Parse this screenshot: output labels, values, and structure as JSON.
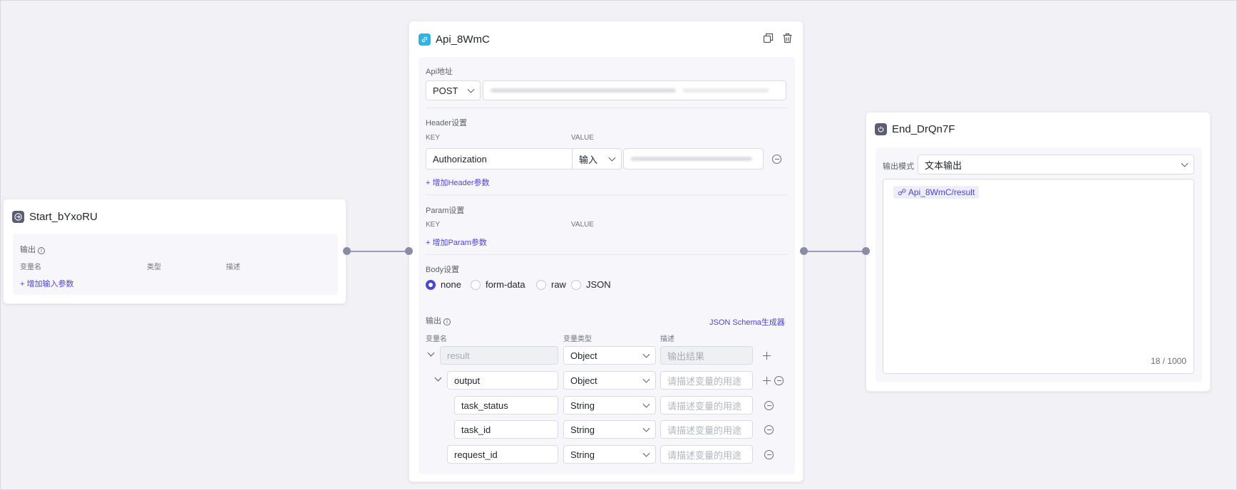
{
  "colors": {
    "accent": "#4b45d6",
    "api_icon": "#29b6e6",
    "node_icon": "#5b5e72"
  },
  "start_node": {
    "title": "Start_bYxoRU",
    "icon": "login-icon",
    "output_label": "输出",
    "columns": [
      "变量名",
      "类型",
      "描述"
    ],
    "add_input_label": "增加输入参数"
  },
  "api_node": {
    "title": "Api_8WmC",
    "icon": "link-icon",
    "copy_icon": "copy-icon",
    "delete_icon": "trash-icon",
    "api_address_label": "Api地址",
    "method": "POST",
    "header_label": "Header设置",
    "key_col": "KEY",
    "value_col": "VALUE",
    "header_key": "Authorization",
    "header_value_type": "输入",
    "add_header_label": "增加Header参数",
    "param_label": "Param设置",
    "add_param_label": "增加Param参数",
    "body_label": "Body设置",
    "body_options": [
      "none",
      "form-data",
      "raw",
      "JSON"
    ],
    "body_selected": "none",
    "output_label": "输出",
    "schema_link": "JSON Schema生成器",
    "output_columns": [
      "变量名",
      "变量类型",
      "描述"
    ],
    "desc_placeholder": "请描述变量的用途",
    "rows": [
      {
        "name": "result",
        "type": "Object",
        "desc": "输出结果"
      },
      {
        "name": "output",
        "type": "Object"
      },
      {
        "name": "task_status",
        "type": "String"
      },
      {
        "name": "task_id",
        "type": "String"
      },
      {
        "name": "request_id",
        "type": "String"
      }
    ]
  },
  "end_node": {
    "title": "End_DrQn7F",
    "icon": "power-icon",
    "output_mode_label": "输出模式",
    "output_mode": "文本输出",
    "tag": "Api_8WmC/result",
    "counter": "18 / 1000"
  }
}
